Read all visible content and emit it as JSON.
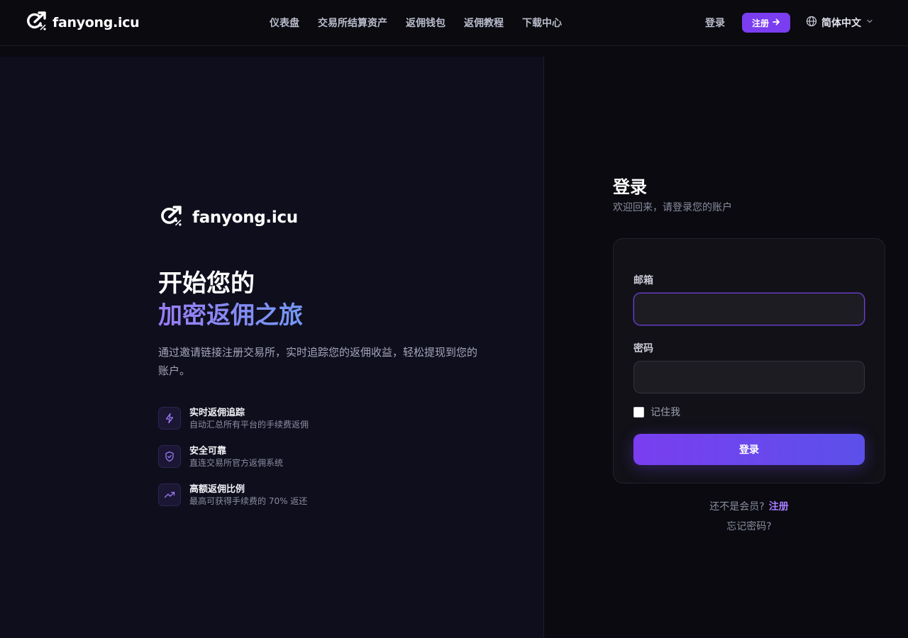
{
  "header": {
    "brand": "fanyong.icu",
    "nav": [
      "仪表盘",
      "交易所结算资产",
      "返佣钱包",
      "返佣教程",
      "下载中心"
    ],
    "login": "登录",
    "register": "注册",
    "language": "简体中文"
  },
  "hero": {
    "brand": "fanyong.icu",
    "title_line1": "开始您的",
    "title_line2": "加密返佣之旅",
    "description": "通过邀请链接注册交易所，实时追踪您的返佣收益，轻松提现到您的账户。",
    "features": [
      {
        "title": "实时返佣追踪",
        "subtitle": "自动汇总所有平台的手续费返佣",
        "icon": "lightning-icon"
      },
      {
        "title": "安全可靠",
        "subtitle": "直连交易所官方返佣系统",
        "icon": "shield-icon"
      },
      {
        "title": "高额返佣比例",
        "subtitle": "最高可获得手续费的 70% 返还",
        "icon": "trending-up-icon"
      }
    ]
  },
  "login": {
    "title": "登录",
    "subtitle": "欢迎回来，请登录您的账户",
    "email_label": "邮箱",
    "email_value": "",
    "password_label": "密码",
    "password_value": "",
    "remember_label": "记住我",
    "submit": "登录",
    "not_member": "还不是会员?",
    "register_link": "注册",
    "forgot": "忘记密码?"
  },
  "colors": {
    "accent": "#7b3df0",
    "accent_link": "#a57cff",
    "left_bg": "#0f0e1d",
    "right_bg": "#0a0a10"
  }
}
